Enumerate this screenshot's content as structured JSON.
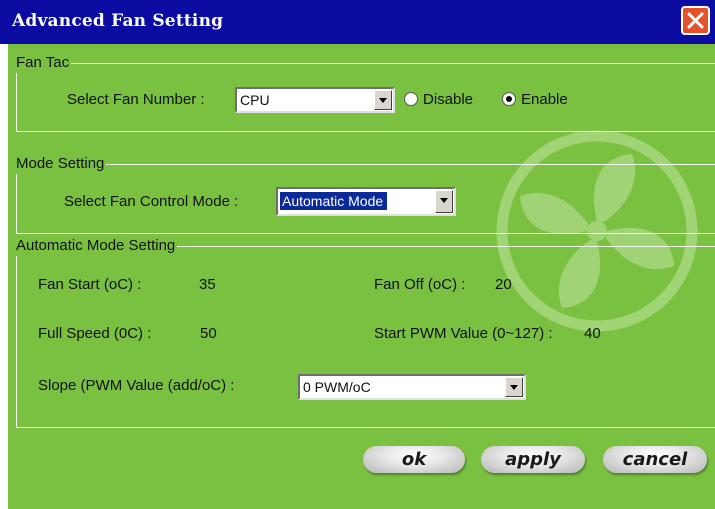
{
  "window": {
    "title": "Advanced Fan Setting"
  },
  "colors": {
    "title_bar": "#0a0ca2",
    "panel": "#7ac142",
    "close_button": "#e4522b"
  },
  "fan_tac": {
    "group_label": "Fan Tac",
    "select_label": "Select Fan Number :",
    "fan_number_value": "CPU",
    "disable_label": "Disable",
    "enable_label": "Enable",
    "selected_option": "Enable"
  },
  "mode_setting": {
    "group_label": "Mode Setting",
    "control_mode_label": "Select Fan Control Mode :",
    "control_mode_value": "Automatic Mode"
  },
  "automatic_mode": {
    "group_label": "Automatic Mode Setting",
    "fan_start_label": "Fan Start (oC) :",
    "fan_start_value": "35",
    "fan_off_label": "Fan Off (oC) :",
    "fan_off_value": "20",
    "full_speed_label": "Full Speed (0C) :",
    "full_speed_value": "50",
    "start_pwm_label": "Start PWM Value (0~127) :",
    "start_pwm_value": "40",
    "slope_label": "Slope (PWM Value (add/oC) :",
    "slope_value": "0 PWM/oC"
  },
  "buttons": {
    "ok": "ok",
    "apply": "apply",
    "cancel": "cancel"
  },
  "icons": {
    "close": "close-icon",
    "watermark": "fan-icon"
  }
}
